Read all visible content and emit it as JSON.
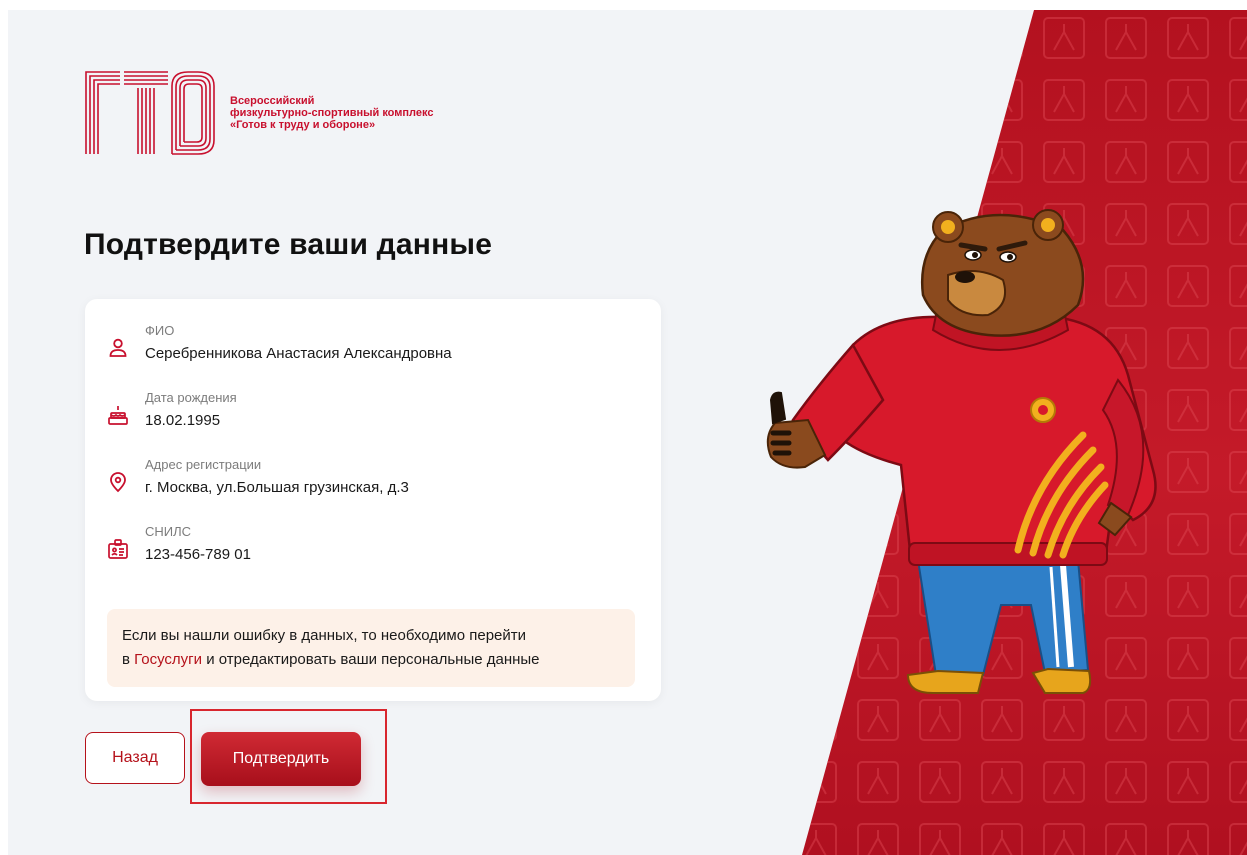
{
  "logo": {
    "lines": [
      "Всероссийский",
      "физкультурно-спортивный комплекс",
      "«Готов к труду и обороне»"
    ]
  },
  "page_title": "Подтвердите ваши данные",
  "fields": {
    "fio": {
      "label": "ФИО",
      "value": "Серебренникова Анастасия Александровна",
      "icon": "person-icon"
    },
    "birth": {
      "label": "Дата рождения",
      "value": "18.02.1995",
      "icon": "cake-icon"
    },
    "address": {
      "label": "Адрес регистрации",
      "value": "г. Москва, ул.Большая грузинская, д.3",
      "icon": "location-pin-icon"
    },
    "snils": {
      "label": "СНИЛС",
      "value": "123-456-789 01",
      "icon": "id-card-icon"
    }
  },
  "notice": {
    "line1": "Если вы нашли ошибку в данных, то необходимо перейти",
    "line2_prefix": "в",
    "line2_link": "Госуслуги",
    "line2_suffix": "и отредактировать ваши персональные данные"
  },
  "buttons": {
    "back": "Назад",
    "confirm": "Подтвердить"
  },
  "colors": {
    "brand_red": "#b5121b",
    "background": "#f2f4f7",
    "notice_bg": "#fdf1e8",
    "mascot_sweater": "#d7192b",
    "mascot_pants": "#2f7fc8"
  }
}
